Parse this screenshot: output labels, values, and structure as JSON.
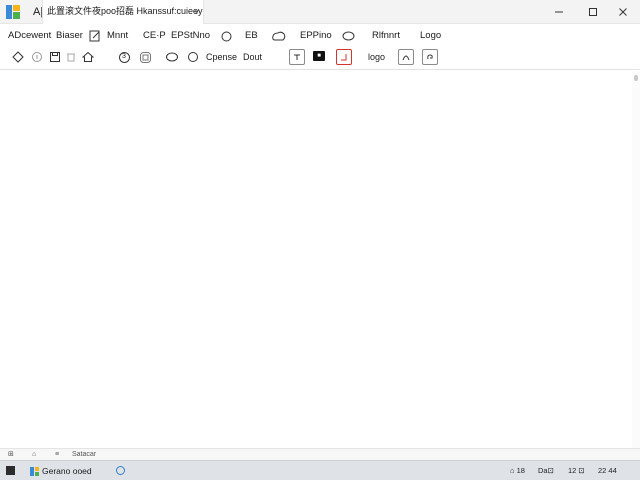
{
  "titlebar": {
    "app_letter": "A|",
    "tab_label": "此置滚文件夜poo招磊 Hkanssuf:cuieeyel",
    "tab_chevron": "˅",
    "controls": {
      "minimize": "–",
      "maximize": "□",
      "close": "✕"
    }
  },
  "menu": {
    "items": [
      "ADcewent",
      "Biaser",
      "Mnnt",
      "CE·P",
      "EPStNno",
      "EB",
      "EPPino",
      "Rlfnnrt",
      "Logo"
    ]
  },
  "toolbar": {
    "circle_label": "3",
    "labels": [
      "Cpense",
      "Dout",
      "logo"
    ],
    "dark_chip_text": "■"
  },
  "statusbar": {
    "items": [
      "⊞",
      "⌂",
      "≡"
    ],
    "text": "Satacar"
  },
  "taskbar": {
    "app_label": "Gerano ooed",
    "tray": [
      "⌂ 18",
      "Da⊡",
      "12 ⊡",
      "22 44"
    ]
  },
  "colors": {
    "app_icon_a": "#3b8ad8",
    "app_icon_b": "#f2b51a",
    "app_icon_c": "#4caf50",
    "accent_red": "#d4332e",
    "taskbar_blue": "#2d7dd2"
  }
}
